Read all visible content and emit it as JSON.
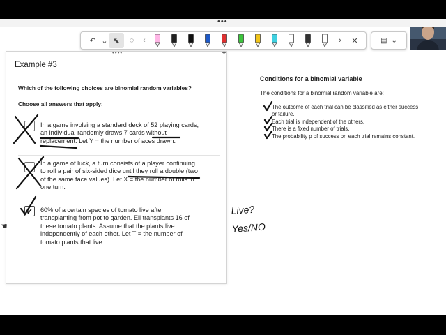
{
  "topbar": {
    "menu_dots": "•••"
  },
  "toolbar": {
    "undo_label": "↶",
    "undo_menu_label": "⌄",
    "select_label": "⬉",
    "lasso_label": "◌",
    "prev_label": "‹",
    "next_label": "›",
    "close_label": "✕",
    "pens": [
      {
        "color": "#ffb6e6",
        "icon": "highlighter-pink-icon"
      },
      {
        "color": "#222222",
        "icon": "pen-a-black-icon"
      },
      {
        "color": "#111111",
        "icon": "pen-black-icon"
      },
      {
        "color": "#1e5ac8",
        "icon": "pen-blue-icon"
      },
      {
        "color": "#e03030",
        "icon": "pen-red-icon"
      },
      {
        "color": "#3cc43c",
        "icon": "pen-green-icon"
      },
      {
        "color": "#f0c419",
        "icon": "pen-yellow-icon"
      },
      {
        "color": "#3fd0e0",
        "icon": "pen-cyan-icon"
      },
      {
        "color": "#ffffff",
        "icon": "pen-white-icon"
      },
      {
        "color": "#333333",
        "icon": "pen-dot-black-icon"
      },
      {
        "color": "#ffffff",
        "icon": "pen-outline-icon"
      }
    ]
  },
  "toolbar2": {
    "device_label": "▤",
    "dropdown_label": "⌄"
  },
  "panel": {
    "title": "Example #3",
    "question": "Which of the following choices are binomial random variables?",
    "instruction": "Choose all answers that apply:",
    "choices": [
      {
        "checked": false,
        "lines": [
          "In a game involving a standard deck of 52 playing cards,",
          "an individual randomly draws 7 cards without",
          "replacement. Let Y = the number of aces drawn."
        ]
      },
      {
        "checked": false,
        "lines": [
          "In a game of luck, a turn consists of a player continuing",
          "to roll a pair of six-sided dice until they roll a double (two",
          "of the same face values). Let X = the number of rolls in",
          "one turn."
        ]
      },
      {
        "checked": true,
        "check_mark": "✓",
        "lines": [
          "60% of a certain species of tomato live after",
          "transplanting from pot to garden. Eli transplants 16 of",
          "these tomato plants. Assume that the plants live",
          "independently of each other. Let T = the number of",
          "tomato plants that live."
        ]
      }
    ]
  },
  "conditions": {
    "title": "Conditions for a binomial variable",
    "intro": "The conditions for a binomial random variable are:",
    "items": [
      {
        "lines": [
          "The outcome of each trial can be classified as either success",
          "or failure."
        ]
      },
      {
        "lines": [
          "Each trial is independent of the others."
        ]
      },
      {
        "lines": [
          "There is a fixed number of trials."
        ]
      },
      {
        "lines": [
          "The probability p of success on each trial remains constant."
        ]
      }
    ]
  },
  "annotation": {
    "line1": "Live?",
    "line2": "Yes/NO"
  },
  "colors": {
    "ink": "#111111",
    "canvas": "#ffffff",
    "frame": "#000000"
  }
}
